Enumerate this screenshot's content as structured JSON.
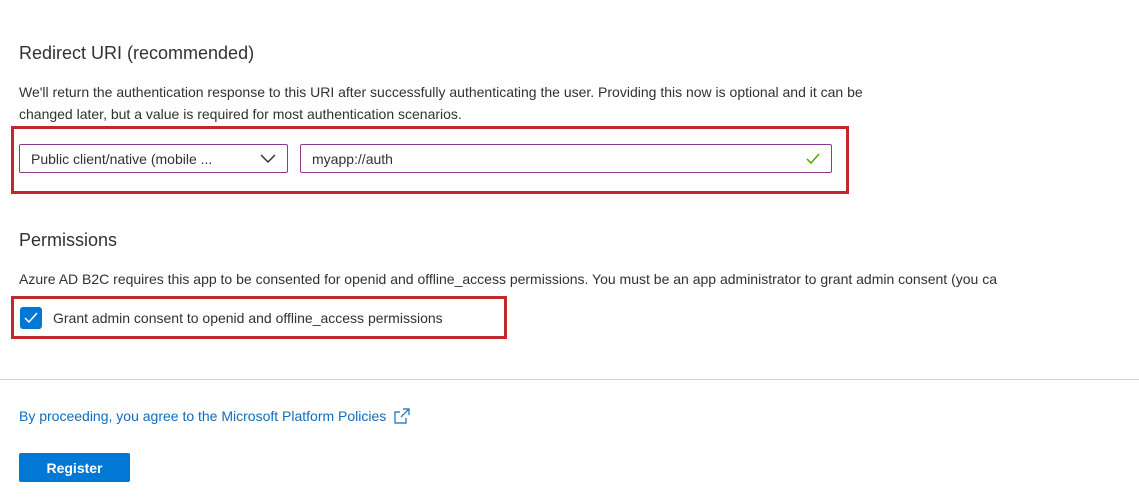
{
  "redirect": {
    "title": "Redirect URI (recommended)",
    "description_line1": "We'll return the authentication response to this URI after successfully authenticating the user. Providing this now is optional and it can be",
    "description_line2": "changed later, but a value is required for most authentication scenarios.",
    "platform_selected": "Public client/native (mobile ...",
    "uri_value": "myapp://auth"
  },
  "permissions": {
    "title": "Permissions",
    "description": "Azure AD B2C requires this app to be consented for openid and offline_access permissions. You must be an app administrator to grant admin consent (you ca",
    "checkbox_label": "Grant admin consent to openid and offline_access permissions",
    "checked": true
  },
  "footer": {
    "policy_link": "By proceeding, you agree to the Microsoft Platform Policies",
    "register_label": "Register"
  },
  "colors": {
    "accent": "#0078d4",
    "highlight": "#c4262e",
    "valid": "#57a300"
  }
}
